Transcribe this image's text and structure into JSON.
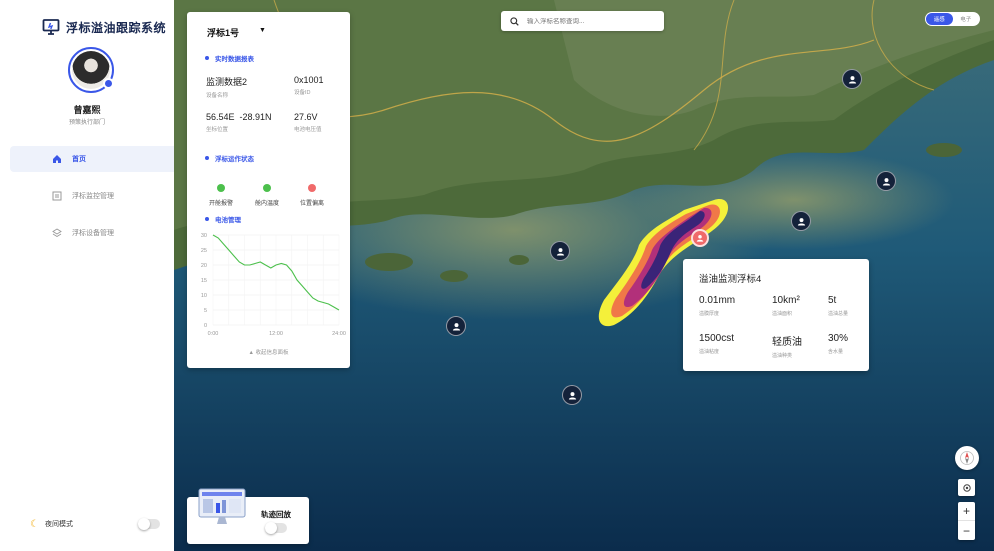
{
  "app": {
    "title": "浮标溢油跟踪系统"
  },
  "user": {
    "name": "曾嘉熙",
    "role": "预策执行部门"
  },
  "nav": [
    {
      "label": "首页",
      "icon": "home-icon",
      "active": true
    },
    {
      "label": "浮标监控管理",
      "icon": "monitor-icon",
      "active": false
    },
    {
      "label": "浮标设备管理",
      "icon": "layers-icon",
      "active": false
    }
  ],
  "night_mode": {
    "label": "夜间模式",
    "enabled": false
  },
  "search": {
    "placeholder": "输入浮标名称查询..."
  },
  "map_layers": {
    "options": [
      "遥感",
      "电子"
    ],
    "selected": "遥感"
  },
  "panel": {
    "title": "浮标1号",
    "realtime_title": "实时数据报表",
    "fields": [
      {
        "value": "监测数据2",
        "label": "设备名称"
      },
      {
        "value": "0x1001",
        "label": "设备ID"
      },
      {
        "value": "56.54E  -28.91N",
        "label": "坐标位置"
      },
      {
        "value": "27.6V",
        "label": "电池电压值"
      }
    ],
    "status_title": "浮标运作状态",
    "statuses": [
      {
        "label": "开舱报警",
        "color": "#4cc04c"
      },
      {
        "label": "舱内温度",
        "color": "#4cc04c"
      },
      {
        "label": "位置偏离",
        "color": "#f06a6a"
      }
    ],
    "battery_title": "电池管理",
    "collapse_label": "收起信息面板"
  },
  "chart_data": {
    "type": "line",
    "x": [
      0,
      1,
      2,
      3,
      4,
      5,
      6,
      7,
      8,
      9,
      10,
      11,
      12,
      13,
      14,
      15,
      16,
      17,
      18,
      19,
      20,
      21,
      22,
      23,
      24
    ],
    "series": [
      {
        "values": [
          30,
          29,
          27,
          25,
          23,
          21,
          20,
          20,
          20.5,
          21,
          20,
          19,
          20,
          20.5,
          20,
          18,
          15,
          13,
          11,
          9,
          8,
          7.5,
          7,
          6,
          5
        ]
      }
    ],
    "ylim": [
      0,
      30
    ],
    "yticks": [
      "0",
      "5",
      "10",
      "15",
      "20",
      "25",
      "30"
    ],
    "xticks": [
      "0:00",
      "12:00",
      "24:00"
    ],
    "line_color": "#4cc04c",
    "grid": true
  },
  "oil_popup": {
    "title": "溢油监测浮标4",
    "cells": [
      {
        "value": "0.01mm",
        "label": "溢膜厚度"
      },
      {
        "value": "10km²",
        "label": "溢油面积"
      },
      {
        "value": "5t",
        "label": "溢油总量"
      },
      {
        "value": "1500cst",
        "label": "溢油粘度"
      },
      {
        "value": "轻质油",
        "label": "溢油种类"
      },
      {
        "value": "30%",
        "label": "含水量"
      }
    ]
  },
  "track": {
    "label": "轨迹回放",
    "enabled": false
  },
  "map_controls": {
    "zoom_in": "+",
    "zoom_out": "−"
  }
}
